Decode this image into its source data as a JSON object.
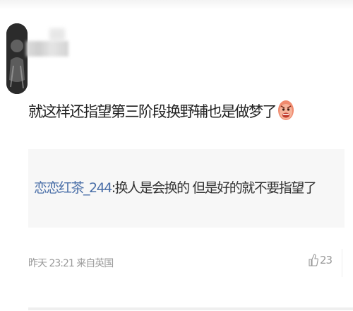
{
  "comment": {
    "text": "就这样还指望第三阶段换野辅也是做梦了",
    "emoji": "angry-face-emoji"
  },
  "reply": {
    "username": "恋恋红茶_244",
    "separator": ":",
    "text": "换人是会换的 但是好的就不要指望了"
  },
  "meta": {
    "time_source": "昨天 23:21 来自英国"
  },
  "like": {
    "count": "23",
    "icon": "thumbs-up-icon"
  },
  "colors": {
    "reply_user": "#4a6fa8",
    "reply_bg": "#f7f7f7",
    "meta_text": "#999999"
  }
}
